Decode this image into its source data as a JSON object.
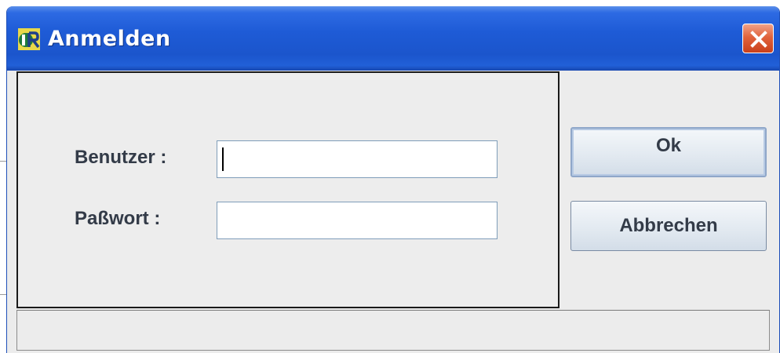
{
  "window": {
    "title": "Anmelden",
    "icon": "app-logo-icon",
    "close_icon": "close-icon"
  },
  "form": {
    "user_label": "Benutzer :",
    "user_value": "",
    "password_label": "Paßwort :",
    "password_value": ""
  },
  "buttons": {
    "ok_label": "Ok",
    "cancel_label": "Abbrechen"
  },
  "status_bar": {
    "text": ""
  },
  "colors": {
    "titlebar": "#1b55cc",
    "close_button": "#e1633c",
    "panel_background": "#ececec",
    "label_text": "#333b48"
  }
}
